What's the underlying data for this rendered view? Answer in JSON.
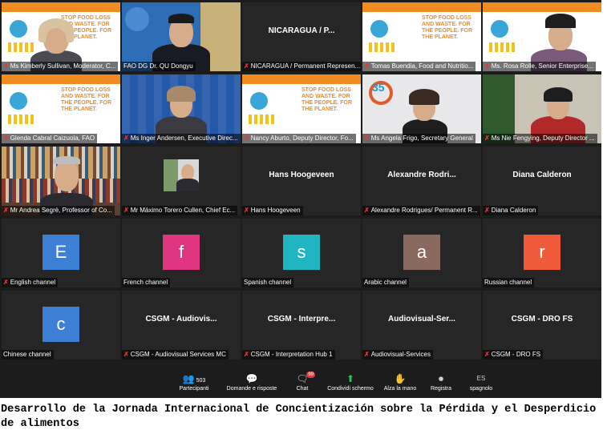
{
  "tiles": [
    {
      "label": "Ms Kimberly Sullivan, Moderator, C...",
      "type": "poster",
      "active": true
    },
    {
      "label": "FAO DG Dr. QU Dongyu",
      "type": "video"
    },
    {
      "label": "NICARAGUA / Permanent Represen...",
      "type": "name",
      "big": "NICARAGUA / P..."
    },
    {
      "label": "Tomas Buendia, Food and Nutritio...",
      "type": "poster"
    },
    {
      "label": "Ms. Rosa Rolle, Senior Enterprise...",
      "type": "video"
    },
    {
      "label": "Glenda Cabral Caizuola, FAO",
      "type": "poster"
    },
    {
      "label": "Ms Inger Andersen, Executive Direc...",
      "type": "video"
    },
    {
      "label": "Nancy Aburto, Deputy Director, Fo...",
      "type": "poster"
    },
    {
      "label": "Ms Angela Frigo, Secretary General",
      "type": "video"
    },
    {
      "label": "Ms Nie Fengying, Deputy Director ...",
      "type": "video"
    },
    {
      "label": "Mr Andrea Segrè, Professor of Co...",
      "type": "video"
    },
    {
      "label": "Mr Máximo Torero Cullen, Chief Ec...",
      "type": "photo"
    },
    {
      "label": "Hans Hoogeveen",
      "type": "name",
      "big": "Hans Hoogeveen"
    },
    {
      "label": "Alexandre Rodrigues/ Permanent R...",
      "type": "name",
      "big": "Alexandre Rodri..."
    },
    {
      "label": "Diana Calderon",
      "type": "name",
      "big": "Diana Calderon"
    },
    {
      "label": "English channel",
      "type": "letter",
      "letter": "E",
      "color": "#3e7fd6"
    },
    {
      "label": "French channel",
      "type": "letter",
      "letter": "f",
      "color": "#e0357f"
    },
    {
      "label": "Spanish channel",
      "type": "letter",
      "letter": "s",
      "color": "#21b5c4"
    },
    {
      "label": "Arabic channel",
      "type": "letter",
      "letter": "a",
      "color": "#8a6a5f"
    },
    {
      "label": "Russian channel",
      "type": "letter",
      "letter": "r",
      "color": "#ef5a3a"
    },
    {
      "label": "Chinese channel",
      "type": "letter",
      "letter": "c",
      "color": "#3e7fd6"
    },
    {
      "label": "CSGM - Audiovisual Services MC",
      "type": "name",
      "big": "CSGM - Audiovis..."
    },
    {
      "label": "CSGM - Interpretation Hub 1",
      "type": "name",
      "big": "CSGM - Interpre..."
    },
    {
      "label": "Audiovisual-Services",
      "type": "name",
      "big": "Audiovisual-Ser..."
    },
    {
      "label": "CSGM - DRO FS",
      "type": "name",
      "big": "CSGM - DRO FS"
    }
  ],
  "toolbar": [
    {
      "label": "Partecipanti",
      "icon": "participants-icon",
      "glyph": "👥",
      "count": "503"
    },
    {
      "label": "Domande e risposte",
      "icon": "qa-icon",
      "glyph": "💬"
    },
    {
      "label": "Chat",
      "icon": "chat-icon",
      "glyph": "🗨",
      "badge": "99"
    },
    {
      "label": "Condividi schermo",
      "icon": "share-screen-icon",
      "glyph": "⬆",
      "green": true
    },
    {
      "label": "Alza la mano",
      "icon": "raise-hand-icon",
      "glyph": "✋"
    },
    {
      "label": "Registra",
      "icon": "record-icon",
      "glyph": "⏺"
    },
    {
      "label": "spagnolo",
      "icon": "interpretation-icon",
      "glyph": "ES"
    }
  ],
  "caption": "Desarrollo de la Jornada Internacional de Concientización sobre la Pérdida y el Desperdicio de alimentos"
}
